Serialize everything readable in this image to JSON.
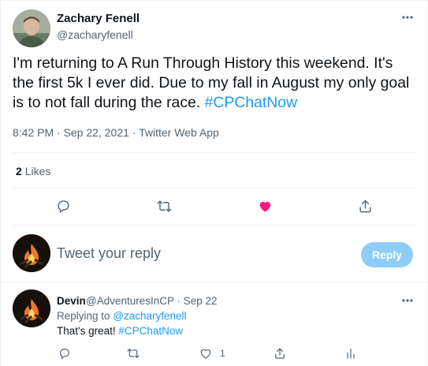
{
  "tweet": {
    "author": {
      "name": "Zachary Fenell",
      "handle": "@zacharyfenell",
      "avatar": "person-avatar"
    },
    "text": "I'm returning to A Run Through History this weekend. It's the first 5k I ever did. Due to my fall in August my only goal is to not fall during the race.",
    "hashtag": "#CPChatNow",
    "time": "8:42 PM",
    "date": "Sep 22, 2021",
    "source": "Twitter Web App",
    "likes_count": "2",
    "likes_label": "Likes",
    "liked": true,
    "actions": [
      "reply-icon",
      "retweet-icon",
      "heart-icon",
      "share-icon"
    ]
  },
  "reply_composer": {
    "placeholder": "Tweet your reply",
    "button_label": "Reply"
  },
  "reply": {
    "name": "Devin",
    "handle": "@AdventuresInCP",
    "date": "Sep 22",
    "replying_to_label": "Replying to",
    "replying_to_handle": "@zacharyfenell",
    "text": "That's great!",
    "hashtag": "#CPChatNow",
    "like_count": "1",
    "actions": [
      "reply-icon",
      "retweet-icon",
      "heart-icon",
      "share-icon",
      "analytics-icon"
    ]
  },
  "colors": {
    "accent": "#1d9bf0",
    "like": "#f91880",
    "muted_text": "#536471",
    "reply_button_disabled": "#8ecdf8"
  }
}
